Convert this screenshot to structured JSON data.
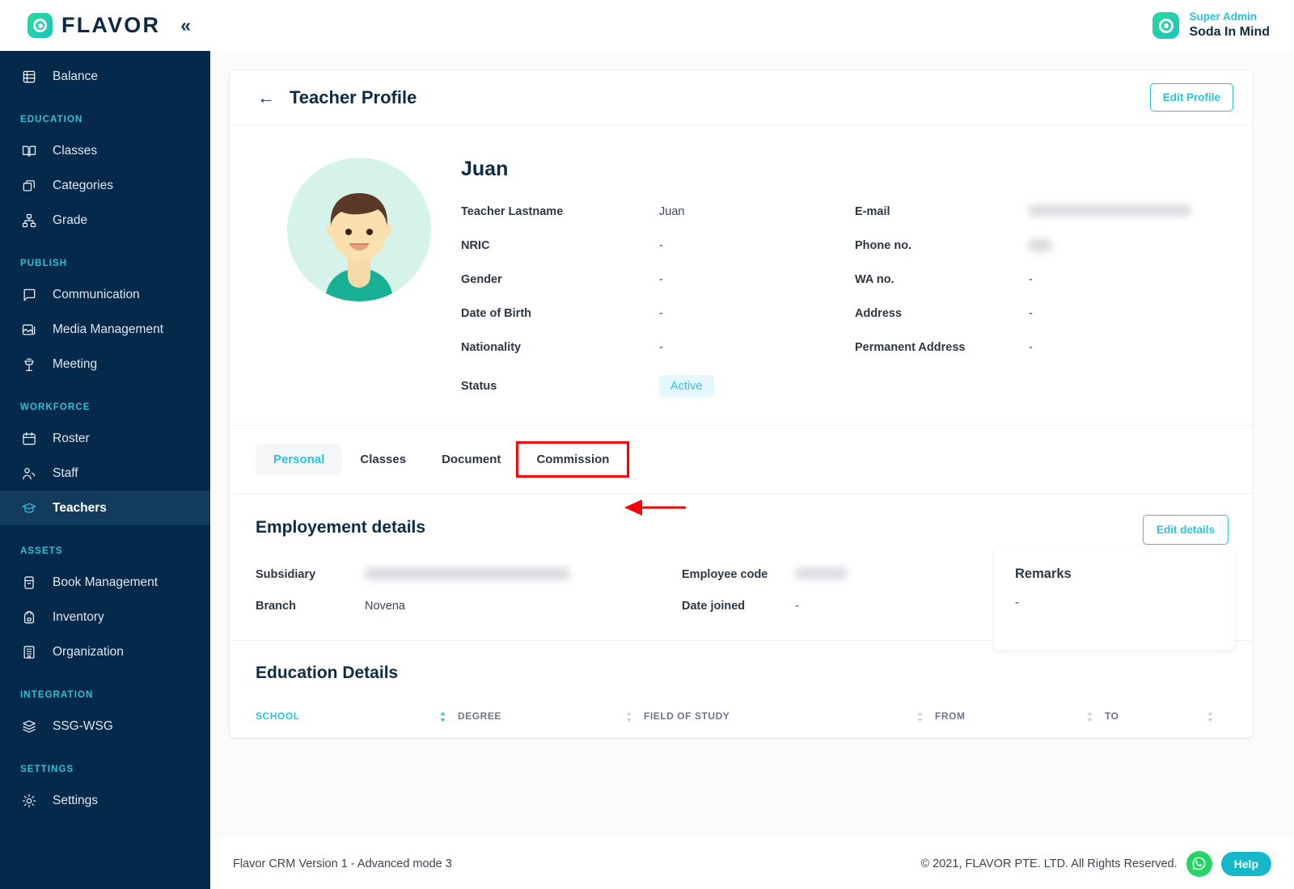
{
  "brand": {
    "name": "FLAVOR",
    "collapse_icon": "chevrons-left-icon"
  },
  "account": {
    "role": "Super Admin",
    "name": "Soda In Mind"
  },
  "sidebar": {
    "groups": [
      {
        "label": "",
        "items": [
          {
            "label": "Balance",
            "icon": "balance-icon"
          }
        ]
      },
      {
        "label": "EDUCATION",
        "items": [
          {
            "label": "Classes",
            "icon": "book-open-icon"
          },
          {
            "label": "Categories",
            "icon": "boxes-icon"
          },
          {
            "label": "Grade",
            "icon": "grade-icon"
          }
        ]
      },
      {
        "label": "PUBLISH",
        "items": [
          {
            "label": "Communication",
            "icon": "chat-icon"
          },
          {
            "label": "Media Management",
            "icon": "image-stack-icon"
          },
          {
            "label": "Meeting",
            "icon": "podium-icon"
          }
        ]
      },
      {
        "label": "WORKFORCE",
        "items": [
          {
            "label": "Roster",
            "icon": "calendar-icon"
          },
          {
            "label": "Staff",
            "icon": "users-icon"
          },
          {
            "label": "Teachers",
            "icon": "graduation-cap-icon",
            "active": true
          }
        ]
      },
      {
        "label": "ASSETS",
        "items": [
          {
            "label": "Book Management",
            "icon": "book-icon"
          },
          {
            "label": "Inventory",
            "icon": "backpack-icon"
          },
          {
            "label": "Organization",
            "icon": "building-icon"
          }
        ]
      },
      {
        "label": "INTEGRATION",
        "items": [
          {
            "label": "SSG-WSG",
            "icon": "layers-icon"
          }
        ]
      },
      {
        "label": "SETTINGS",
        "items": [
          {
            "label": "Settings",
            "icon": "gear-icon"
          }
        ]
      }
    ]
  },
  "page": {
    "title": "Teacher Profile",
    "back_icon": "arrow-left-icon",
    "edit_profile_label": "Edit Profile"
  },
  "profile": {
    "avatar_icon": "user-avatar-illustration",
    "name": "Juan",
    "left_fields": [
      {
        "label": "Teacher Lastname",
        "value": "Juan",
        "redacted": false
      },
      {
        "label": "NRIC",
        "value": "-",
        "redacted": false
      },
      {
        "label": "Gender",
        "value": "-",
        "redacted": false
      },
      {
        "label": "Date of Birth",
        "value": "-",
        "redacted": false
      },
      {
        "label": "Nationality",
        "value": "-",
        "redacted": false
      }
    ],
    "right_fields": [
      {
        "label": "E-mail",
        "value": "",
        "redacted": true
      },
      {
        "label": "Phone no.",
        "value": "",
        "redacted": true
      },
      {
        "label": "WA no.",
        "value": "-",
        "redacted": false
      },
      {
        "label": "Address",
        "value": "-",
        "redacted": false
      },
      {
        "label": "Permanent Address",
        "value": "-",
        "redacted": false
      }
    ],
    "status_label": "Status",
    "status_value": "Active"
  },
  "tabs": [
    {
      "label": "Personal",
      "active": true
    },
    {
      "label": "Classes",
      "active": false
    },
    {
      "label": "Document",
      "active": false
    },
    {
      "label": "Commission",
      "active": false,
      "highlighted": true
    }
  ],
  "annotation": {
    "shape": "arrow-left-pointing",
    "color": "#fb0007"
  },
  "employment": {
    "title": "Employement details",
    "edit_label": "Edit details",
    "fields": [
      {
        "label": "Subsidiary",
        "value": "",
        "redacted": true
      },
      {
        "label": "Employee code",
        "value": "",
        "redacted": true
      },
      {
        "label": "Branch",
        "value": "Novena",
        "redacted": false
      },
      {
        "label": "Date joined",
        "value": "-",
        "redacted": false
      }
    ],
    "remarks": {
      "title": "Remarks",
      "value": "-"
    }
  },
  "education": {
    "title": "Education Details",
    "columns": [
      {
        "label": "SCHOOL",
        "sorted": true
      },
      {
        "label": "DEGREE",
        "sorted": false
      },
      {
        "label": "FIELD OF STUDY",
        "sorted": false
      },
      {
        "label": "FROM",
        "sorted": false
      },
      {
        "label": "TO",
        "sorted": false
      }
    ]
  },
  "footer": {
    "version": "Flavor CRM Version 1 - Advanced mode 3",
    "copyright": "© 2021, FLAVOR PTE. LTD. All Rights Reserved.",
    "whatsapp_icon": "whatsapp-icon",
    "help_label": "Help"
  },
  "colors": {
    "sidebar_bg": "#04294a",
    "accent_teal": "#2bc4d8",
    "section_label": "#2fc2d6",
    "heading": "#0d2b45",
    "annotation_red": "#fb0007",
    "status_bg": "#e4f7fd",
    "whatsapp_green": "#25d366"
  }
}
